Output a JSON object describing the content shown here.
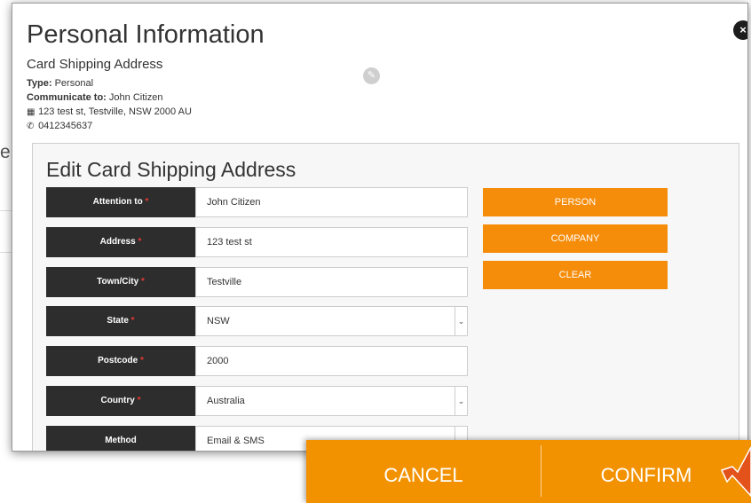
{
  "background": {
    "partial_text": "er"
  },
  "modal": {
    "title": "Personal Information",
    "subtitle": "Card Shipping Address",
    "type_label": "Type:",
    "type_value": "Personal",
    "communicate_label": "Communicate to:",
    "communicate_value": "John Citizen",
    "address_line": "123 test st, Testville, NSW 2000 AU",
    "phone": "0412345637",
    "close_glyph": "×",
    "edit_icon": "edit-icon"
  },
  "form": {
    "title": "Edit Card Shipping Address",
    "fields": [
      {
        "label": "Attention to",
        "required": true,
        "value": "John Citizen",
        "type": "text"
      },
      {
        "label": "Address",
        "required": true,
        "value": "123 test st",
        "type": "text"
      },
      {
        "label": "Town/City",
        "required": true,
        "value": "Testville",
        "type": "text"
      },
      {
        "label": "State",
        "required": true,
        "value": "NSW",
        "type": "select"
      },
      {
        "label": "Postcode",
        "required": true,
        "value": "2000",
        "type": "text"
      },
      {
        "label": "Country",
        "required": true,
        "value": "Australia",
        "type": "select"
      },
      {
        "label": "Method",
        "required": false,
        "value": "Email & SMS",
        "type": "select"
      }
    ],
    "required_marker": "*"
  },
  "side_buttons": {
    "person": "PERSON",
    "company": "COMPANY",
    "clear": "CLEAR"
  },
  "actions": {
    "cancel": "CANCEL",
    "confirm": "CONFIRM"
  },
  "colors": {
    "accent_orange": "#f58c0a",
    "action_bar": "#f39200",
    "label_bg": "#2d2d2d",
    "required_red": "#e53935"
  }
}
